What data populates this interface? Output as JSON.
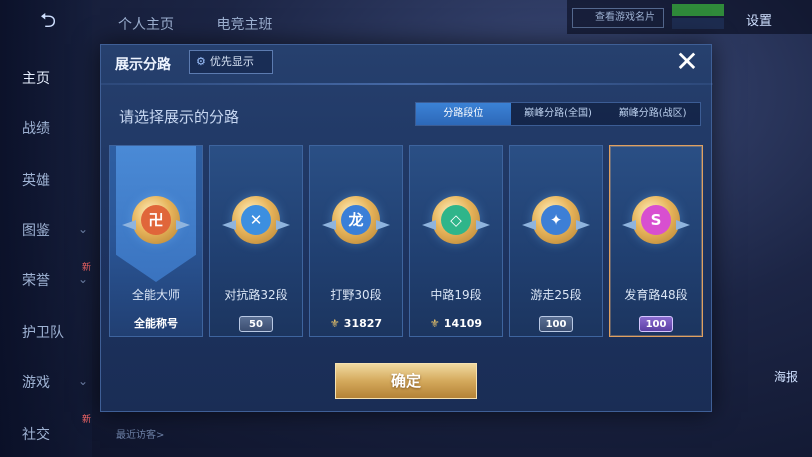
{
  "top_tabs": [
    "个人主页",
    "电竞主班"
  ],
  "header": {
    "card_chip": "查看游戏名片",
    "settings": "设置"
  },
  "nav": [
    {
      "label": "主页",
      "active": true
    },
    {
      "label": "战绩",
      "active": false
    },
    {
      "label": "英雄",
      "active": false
    },
    {
      "label": "图鉴",
      "active": false
    },
    {
      "label": "荣誉",
      "active": false
    },
    {
      "label": "护卫队",
      "active": false
    },
    {
      "label": "游戏",
      "active": false
    },
    {
      "label": "社交",
      "active": false
    }
  ],
  "nav_new_badge": "新",
  "right_side": {
    "poster": "海报"
  },
  "recent_visitors": "最近访客>",
  "dialog": {
    "title": "展示分路",
    "priority_button": "优先显示",
    "subtitle": "请选择展示的分路",
    "tabs": [
      {
        "label": "分路段位",
        "active": true
      },
      {
        "label": "巅峰分路(全国)",
        "active": false
      },
      {
        "label": "巅峰分路(战区)",
        "active": false
      }
    ],
    "confirm": "确定"
  },
  "cards": [
    {
      "name": "全能大师",
      "footer_text": "全能称号",
      "footer_type": "title",
      "emblem_glyph": "卍",
      "emblem_color": "#e0663a",
      "selected": false
    },
    {
      "name": "对抗路32段",
      "footer_text": "50",
      "footer_type": "badge",
      "emblem_glyph": "✕",
      "emblem_color": "#3c8fe0",
      "selected": false
    },
    {
      "name": "打野30段",
      "footer_text": "31827",
      "footer_type": "stat",
      "emblem_glyph": "龙",
      "emblem_color": "#3a7fd8",
      "selected": false
    },
    {
      "name": "中路19段",
      "footer_text": "14109",
      "footer_type": "stat",
      "emblem_glyph": "◇",
      "emblem_color": "#2fb58a",
      "selected": false
    },
    {
      "name": "游走25段",
      "footer_text": "100",
      "footer_type": "badge",
      "emblem_glyph": "✦",
      "emblem_color": "#3d7fd6",
      "selected": false
    },
    {
      "name": "发育路48段",
      "footer_text": "100",
      "footer_type": "badge_purple",
      "emblem_glyph": "S",
      "emblem_color": "#d84fd0",
      "selected": true
    }
  ],
  "colors": {
    "accent_tab": "#3b82d6",
    "confirm_gold": "#d4a95c",
    "selected_border": "#e0a060"
  }
}
